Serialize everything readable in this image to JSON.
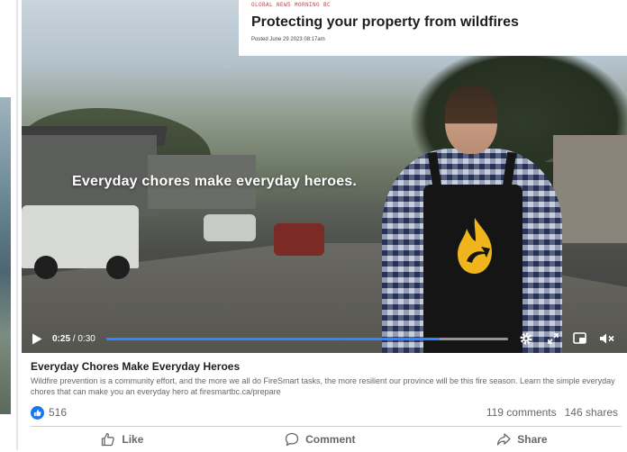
{
  "news_card": {
    "source": "GLOBAL NEWS MORNING BC",
    "title": "Protecting your property from wildfires",
    "posted": "Posted June 29 2023 08:17am"
  },
  "video": {
    "overlay_caption": "Everyday chores make everyday heroes.",
    "current_time": "0:25",
    "duration": "/ 0:30",
    "progress_fraction": 0.83,
    "accent_color": "#2d88ff"
  },
  "controls": {
    "icons": [
      "play-icon",
      "settings-gear-icon",
      "fullscreen-icon",
      "picture-in-picture-icon",
      "volume-muted-icon"
    ]
  },
  "post": {
    "title": "Everyday Chores Make Everyday Heroes",
    "description": "Wildfire prevention is a community effort, and the more we all do FireSmart tasks, the more resilient our province will be this fire season. Learn the simple everyday chores that can make you an everyday hero at firesmartbc.ca/prepare",
    "like_count": "516",
    "comments": "119 comments",
    "shares": "146 shares",
    "brand_color": "#1877f2"
  },
  "actions": {
    "like": "Like",
    "comment": "Comment",
    "share": "Share"
  }
}
